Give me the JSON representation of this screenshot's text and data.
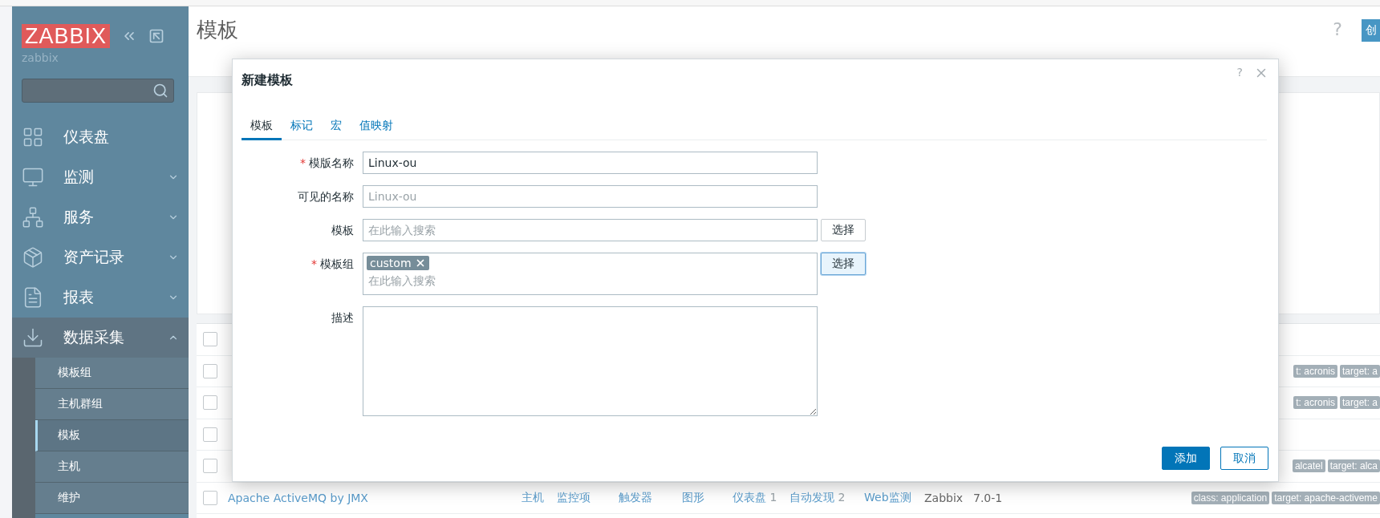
{
  "sidebar": {
    "logo": "ZABBIX",
    "server_name": "zabbix",
    "menu": [
      {
        "label": "仪表盘",
        "expandable": false,
        "expanded": false
      },
      {
        "label": "监测",
        "expandable": true,
        "expanded": false
      },
      {
        "label": "服务",
        "expandable": true,
        "expanded": false
      },
      {
        "label": "资产记录",
        "expandable": true,
        "expanded": false
      },
      {
        "label": "报表",
        "expandable": true,
        "expanded": false
      },
      {
        "label": "数据采集",
        "expandable": true,
        "expanded": true,
        "children": [
          {
            "label": "模板组",
            "selected": false
          },
          {
            "label": "主机群组",
            "selected": false
          },
          {
            "label": "模板",
            "selected": true
          },
          {
            "label": "主机",
            "selected": false
          },
          {
            "label": "维护",
            "selected": false
          }
        ]
      }
    ]
  },
  "header": {
    "title": "模板",
    "help": "?",
    "create_button": "创"
  },
  "table": {
    "header_checked": false,
    "rows": [
      {
        "checked": false,
        "tags": [
          "t: acronis",
          "target: a"
        ]
      },
      {
        "checked": false,
        "tags": [
          "t: acronis",
          "target: a"
        ]
      },
      {
        "checked": false,
        "tags": []
      },
      {
        "checked": false,
        "tags": [
          "alcatel",
          "target: alca"
        ]
      },
      {
        "name": "Apache ActiveMQ by JMX",
        "checked": false,
        "links": [
          {
            "label": "主机"
          },
          {
            "label": "监控项"
          },
          {
            "label": "触发器"
          },
          {
            "label": "图形"
          },
          {
            "label": "仪表盘",
            "count": "1"
          },
          {
            "label": "自动发现",
            "count": "2"
          },
          {
            "label": "Web监测"
          }
        ],
        "vendor": "Zabbix",
        "version": "7.0-1",
        "tags": [
          "class: application",
          "target: apache-activeme"
        ]
      }
    ]
  },
  "modal": {
    "title": "新建模板",
    "help": "?",
    "required_mark": "*",
    "tabs": [
      {
        "label": "模板",
        "selected": true
      },
      {
        "label": "标记",
        "selected": false
      },
      {
        "label": "宏",
        "selected": false
      },
      {
        "label": "值映射",
        "selected": false
      }
    ],
    "fields": [
      {
        "kind": "text",
        "label": "模版名称",
        "required": true,
        "value": "Linux-ou"
      },
      {
        "kind": "text",
        "label": "可见的名称",
        "required": false,
        "placeholder": "Linux-ou"
      },
      {
        "kind": "select",
        "label": "模板",
        "required": false,
        "placeholder": "在此输入搜索",
        "button": "选择",
        "focused": false
      },
      {
        "kind": "multiselect",
        "label": "模板组",
        "required": true,
        "chips": [
          "custom"
        ],
        "placeholder": "在此输入搜索",
        "button": "选择",
        "focused": true
      },
      {
        "kind": "textarea",
        "label": "描述",
        "required": false
      }
    ],
    "buttons": [
      {
        "label": "添加",
        "primary": true
      },
      {
        "label": "取消",
        "primary": false
      }
    ]
  }
}
